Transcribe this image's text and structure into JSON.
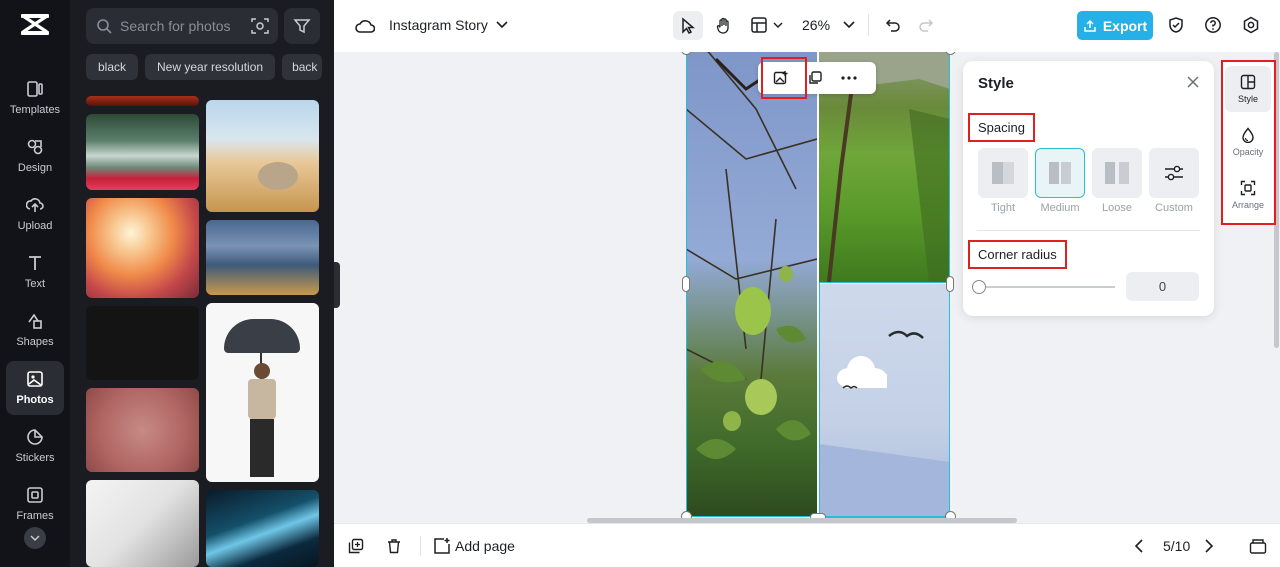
{
  "colors": {
    "accent": "#26b0e8",
    "selection": "#26c0d3",
    "highlight": "#e02020"
  },
  "left_rail": {
    "items": [
      {
        "label": "Templates",
        "icon": "templates-icon"
      },
      {
        "label": "Design",
        "icon": "design-icon"
      },
      {
        "label": "Upload",
        "icon": "upload-icon"
      },
      {
        "label": "Text",
        "icon": "text-icon"
      },
      {
        "label": "Shapes",
        "icon": "shapes-icon"
      },
      {
        "label": "Photos",
        "icon": "photos-icon",
        "active": true
      },
      {
        "label": "Stickers",
        "icon": "stickers-icon"
      },
      {
        "label": "Frames",
        "icon": "frames-icon"
      }
    ]
  },
  "photo_panel": {
    "search_placeholder": "Search for photos",
    "chips": [
      "black",
      "New year resolution",
      "back"
    ]
  },
  "topbar": {
    "document_title": "Instagram Story",
    "zoom": "26%",
    "export_label": "Export"
  },
  "style_panel": {
    "title": "Style",
    "spacing_label": "Spacing",
    "spacing_options": [
      {
        "label": "Tight"
      },
      {
        "label": "Medium",
        "selected": true
      },
      {
        "label": "Loose"
      },
      {
        "label": "Custom"
      }
    ],
    "corner_radius_label": "Corner radius",
    "corner_radius_value": "0"
  },
  "right_rail": {
    "items": [
      {
        "label": "Style",
        "icon": "layout-icon",
        "active": true
      },
      {
        "label": "Opacity",
        "icon": "opacity-icon"
      },
      {
        "label": "Arrange",
        "icon": "arrange-icon"
      }
    ]
  },
  "bottombar": {
    "add_page_label": "Add page",
    "page_indicator": "5/10"
  }
}
